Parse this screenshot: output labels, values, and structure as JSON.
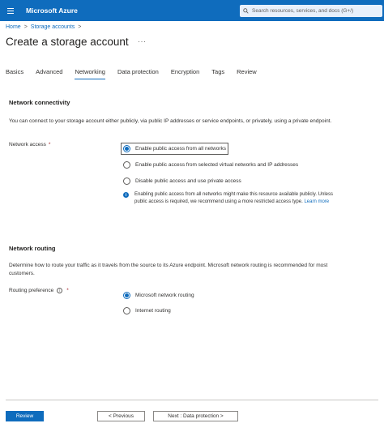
{
  "header": {
    "brand": "Microsoft Azure",
    "search_placeholder": "Search resources, services, and docs (G+/)"
  },
  "breadcrumb": {
    "items": [
      "Home",
      "Storage accounts"
    ],
    "separator": ">"
  },
  "page": {
    "title": "Create a storage account",
    "more": "···"
  },
  "tabs": [
    {
      "label": "Basics",
      "active": false
    },
    {
      "label": "Advanced",
      "active": false
    },
    {
      "label": "Networking",
      "active": true
    },
    {
      "label": "Data protection",
      "active": false
    },
    {
      "label": "Encryption",
      "active": false
    },
    {
      "label": "Tags",
      "active": false
    },
    {
      "label": "Review",
      "active": false
    }
  ],
  "connectivity": {
    "title": "Network connectivity",
    "description": "You can connect to your storage account either publicly, via public IP addresses or service endpoints, or privately, using a private endpoint.",
    "field_label": "Network access",
    "required_mark": "*",
    "options": [
      {
        "label": "Enable public access from all networks",
        "selected": true
      },
      {
        "label": "Enable public access from selected virtual networks and IP addresses",
        "selected": false
      },
      {
        "label": "Disable public access and use private access",
        "selected": false
      }
    ],
    "info_text": "Enabling public access from all networks might make this resource available publicly. Unless public access is required, we recommend using a more restricted access type.",
    "info_link": "Learn more"
  },
  "routing": {
    "title": "Network routing",
    "description": "Determine how to route your traffic as it travels from the source to its Azure endpoint. Microsoft network routing is recommended for most customers.",
    "field_label": "Routing preference",
    "required_mark": "*",
    "info_glyph": "i",
    "options": [
      {
        "label": "Microsoft network routing",
        "selected": true
      },
      {
        "label": "Internet routing",
        "selected": false
      }
    ]
  },
  "footer": {
    "review_label": "Review",
    "previous_label": "< Previous",
    "next_label": "Next : Data protection >"
  },
  "colors": {
    "accent": "#0f6cbd",
    "required": "#a4262c"
  }
}
